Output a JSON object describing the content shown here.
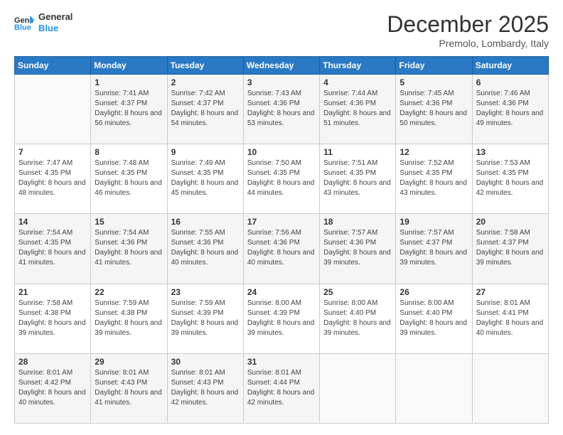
{
  "header": {
    "logo_line1": "General",
    "logo_line2": "Blue",
    "month": "December 2025",
    "location": "Premolo, Lombardy, Italy"
  },
  "weekdays": [
    "Sunday",
    "Monday",
    "Tuesday",
    "Wednesday",
    "Thursday",
    "Friday",
    "Saturday"
  ],
  "weeks": [
    [
      {
        "day": "",
        "sunrise": "",
        "sunset": "",
        "daylight": ""
      },
      {
        "day": "1",
        "sunrise": "Sunrise: 7:41 AM",
        "sunset": "Sunset: 4:37 PM",
        "daylight": "Daylight: 8 hours and 56 minutes."
      },
      {
        "day": "2",
        "sunrise": "Sunrise: 7:42 AM",
        "sunset": "Sunset: 4:37 PM",
        "daylight": "Daylight: 8 hours and 54 minutes."
      },
      {
        "day": "3",
        "sunrise": "Sunrise: 7:43 AM",
        "sunset": "Sunset: 4:36 PM",
        "daylight": "Daylight: 8 hours and 53 minutes."
      },
      {
        "day": "4",
        "sunrise": "Sunrise: 7:44 AM",
        "sunset": "Sunset: 4:36 PM",
        "daylight": "Daylight: 8 hours and 51 minutes."
      },
      {
        "day": "5",
        "sunrise": "Sunrise: 7:45 AM",
        "sunset": "Sunset: 4:36 PM",
        "daylight": "Daylight: 8 hours and 50 minutes."
      },
      {
        "day": "6",
        "sunrise": "Sunrise: 7:46 AM",
        "sunset": "Sunset: 4:36 PM",
        "daylight": "Daylight: 8 hours and 49 minutes."
      }
    ],
    [
      {
        "day": "7",
        "sunrise": "Sunrise: 7:47 AM",
        "sunset": "Sunset: 4:35 PM",
        "daylight": "Daylight: 8 hours and 48 minutes."
      },
      {
        "day": "8",
        "sunrise": "Sunrise: 7:48 AM",
        "sunset": "Sunset: 4:35 PM",
        "daylight": "Daylight: 8 hours and 46 minutes."
      },
      {
        "day": "9",
        "sunrise": "Sunrise: 7:49 AM",
        "sunset": "Sunset: 4:35 PM",
        "daylight": "Daylight: 8 hours and 45 minutes."
      },
      {
        "day": "10",
        "sunrise": "Sunrise: 7:50 AM",
        "sunset": "Sunset: 4:35 PM",
        "daylight": "Daylight: 8 hours and 44 minutes."
      },
      {
        "day": "11",
        "sunrise": "Sunrise: 7:51 AM",
        "sunset": "Sunset: 4:35 PM",
        "daylight": "Daylight: 8 hours and 43 minutes."
      },
      {
        "day": "12",
        "sunrise": "Sunrise: 7:52 AM",
        "sunset": "Sunset: 4:35 PM",
        "daylight": "Daylight: 8 hours and 43 minutes."
      },
      {
        "day": "13",
        "sunrise": "Sunrise: 7:53 AM",
        "sunset": "Sunset: 4:35 PM",
        "daylight": "Daylight: 8 hours and 42 minutes."
      }
    ],
    [
      {
        "day": "14",
        "sunrise": "Sunrise: 7:54 AM",
        "sunset": "Sunset: 4:35 PM",
        "daylight": "Daylight: 8 hours and 41 minutes."
      },
      {
        "day": "15",
        "sunrise": "Sunrise: 7:54 AM",
        "sunset": "Sunset: 4:36 PM",
        "daylight": "Daylight: 8 hours and 41 minutes."
      },
      {
        "day": "16",
        "sunrise": "Sunrise: 7:55 AM",
        "sunset": "Sunset: 4:36 PM",
        "daylight": "Daylight: 8 hours and 40 minutes."
      },
      {
        "day": "17",
        "sunrise": "Sunrise: 7:56 AM",
        "sunset": "Sunset: 4:36 PM",
        "daylight": "Daylight: 8 hours and 40 minutes."
      },
      {
        "day": "18",
        "sunrise": "Sunrise: 7:57 AM",
        "sunset": "Sunset: 4:36 PM",
        "daylight": "Daylight: 8 hours and 39 minutes."
      },
      {
        "day": "19",
        "sunrise": "Sunrise: 7:57 AM",
        "sunset": "Sunset: 4:37 PM",
        "daylight": "Daylight: 8 hours and 39 minutes."
      },
      {
        "day": "20",
        "sunrise": "Sunrise: 7:58 AM",
        "sunset": "Sunset: 4:37 PM",
        "daylight": "Daylight: 8 hours and 39 minutes."
      }
    ],
    [
      {
        "day": "21",
        "sunrise": "Sunrise: 7:58 AM",
        "sunset": "Sunset: 4:38 PM",
        "daylight": "Daylight: 8 hours and 39 minutes."
      },
      {
        "day": "22",
        "sunrise": "Sunrise: 7:59 AM",
        "sunset": "Sunset: 4:38 PM",
        "daylight": "Daylight: 8 hours and 39 minutes."
      },
      {
        "day": "23",
        "sunrise": "Sunrise: 7:59 AM",
        "sunset": "Sunset: 4:39 PM",
        "daylight": "Daylight: 8 hours and 39 minutes."
      },
      {
        "day": "24",
        "sunrise": "Sunrise: 8:00 AM",
        "sunset": "Sunset: 4:39 PM",
        "daylight": "Daylight: 8 hours and 39 minutes."
      },
      {
        "day": "25",
        "sunrise": "Sunrise: 8:00 AM",
        "sunset": "Sunset: 4:40 PM",
        "daylight": "Daylight: 8 hours and 39 minutes."
      },
      {
        "day": "26",
        "sunrise": "Sunrise: 8:00 AM",
        "sunset": "Sunset: 4:40 PM",
        "daylight": "Daylight: 8 hours and 39 minutes."
      },
      {
        "day": "27",
        "sunrise": "Sunrise: 8:01 AM",
        "sunset": "Sunset: 4:41 PM",
        "daylight": "Daylight: 8 hours and 40 minutes."
      }
    ],
    [
      {
        "day": "28",
        "sunrise": "Sunrise: 8:01 AM",
        "sunset": "Sunset: 4:42 PM",
        "daylight": "Daylight: 8 hours and 40 minutes."
      },
      {
        "day": "29",
        "sunrise": "Sunrise: 8:01 AM",
        "sunset": "Sunset: 4:43 PM",
        "daylight": "Daylight: 8 hours and 41 minutes."
      },
      {
        "day": "30",
        "sunrise": "Sunrise: 8:01 AM",
        "sunset": "Sunset: 4:43 PM",
        "daylight": "Daylight: 8 hours and 42 minutes."
      },
      {
        "day": "31",
        "sunrise": "Sunrise: 8:01 AM",
        "sunset": "Sunset: 4:44 PM",
        "daylight": "Daylight: 8 hours and 42 minutes."
      },
      {
        "day": "",
        "sunrise": "",
        "sunset": "",
        "daylight": ""
      },
      {
        "day": "",
        "sunrise": "",
        "sunset": "",
        "daylight": ""
      },
      {
        "day": "",
        "sunrise": "",
        "sunset": "",
        "daylight": ""
      }
    ]
  ]
}
